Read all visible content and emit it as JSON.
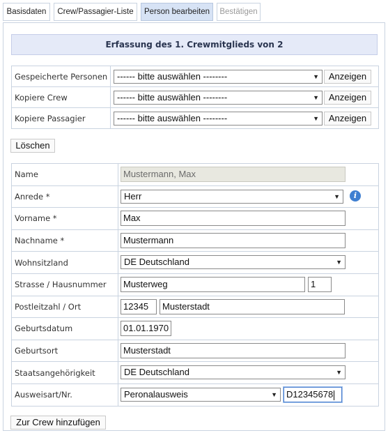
{
  "tabs": [
    {
      "label": "Basisdaten",
      "state": "normal"
    },
    {
      "label": "Crew/Passagier-Liste",
      "state": "normal"
    },
    {
      "label": "Person bearbeiten",
      "state": "active"
    },
    {
      "label": "Bestätigen",
      "state": "disabled"
    }
  ],
  "page_title": "Erfassung des 1. Crewmitglieds von 2",
  "copy_section": {
    "rows": [
      {
        "label": "Gespeicherte Personen",
        "select": "------ bitte auswählen --------",
        "button": "Anzeigen"
      },
      {
        "label": "Kopiere Crew",
        "select": "------ bitte auswählen --------",
        "button": "Anzeigen"
      },
      {
        "label": "Kopiere Passagier",
        "select": "------ bitte auswählen --------",
        "button": "Anzeigen"
      }
    ]
  },
  "delete_button": "Löschen",
  "form": {
    "name": {
      "label": "Name",
      "value": "Mustermann, Max"
    },
    "anrede": {
      "label": "Anrede *",
      "value": "Herr"
    },
    "vorname": {
      "label": "Vorname *",
      "value": "Max"
    },
    "nachname": {
      "label": "Nachname *",
      "value": "Mustermann"
    },
    "wohnsitzland": {
      "label": "Wohnsitzland",
      "value": "DE Deutschland"
    },
    "strasse": {
      "label": "Strasse / Hausnummer",
      "street": "Musterweg",
      "number": "1"
    },
    "plz_ort": {
      "label": "Postleitzahl / Ort",
      "plz": "12345",
      "ort": "Musterstadt"
    },
    "geburtsdatum": {
      "label": "Geburtsdatum",
      "value": "01.01.1970"
    },
    "geburtsort": {
      "label": "Geburtsort",
      "value": "Musterstadt"
    },
    "staatsangehoerigkeit": {
      "label": "Staatsangehörigkeit",
      "value": "DE Deutschland"
    },
    "ausweis": {
      "label": "Ausweisart/Nr.",
      "type": "Peronalausweis",
      "number": "D12345678"
    }
  },
  "add_button": "Zur Crew hinzufügen",
  "icons": {
    "select_arrow": "▼",
    "info": "i"
  },
  "colors": {
    "accent": "#3f7fd1",
    "title_bg": "#e5eaf8",
    "active_tab_bg": "#d7e3f5",
    "border": "#c9d3e0"
  }
}
